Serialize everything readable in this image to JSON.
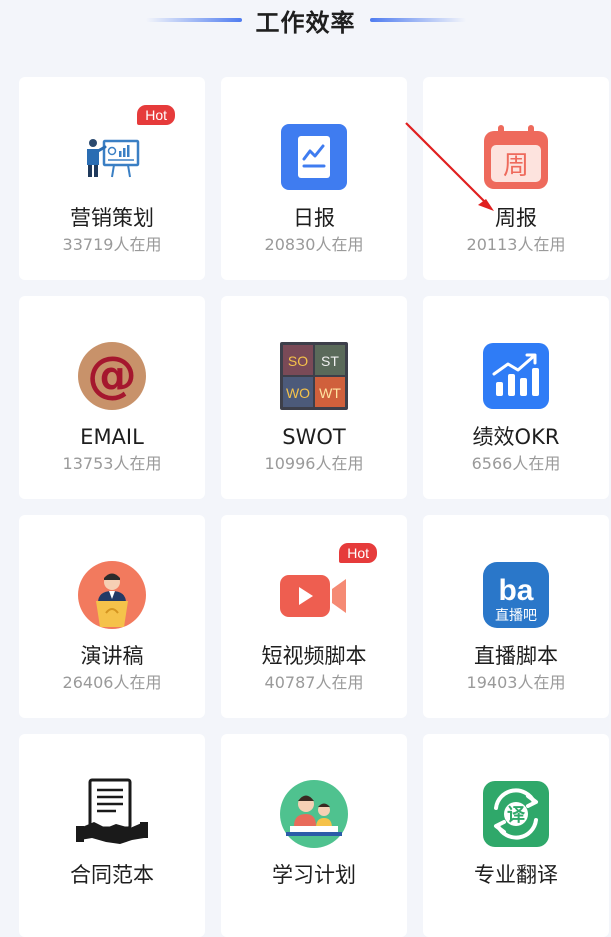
{
  "header": {
    "title": "工作效率"
  },
  "badge_text": "Hot",
  "colors": {
    "accent": "#4f7cf0",
    "hot": "#e63b3b",
    "user_count": "#9a9a9a"
  },
  "tools": [
    {
      "name": "营销策划",
      "users": "33719人在用",
      "icon": "presentation-board-icon",
      "hot": true
    },
    {
      "name": "日报",
      "users": "20830人在用",
      "icon": "daily-report-icon",
      "hot": false
    },
    {
      "name": "周报",
      "users": "20113人在用",
      "icon": "calendar-icon",
      "icon_text": "周",
      "hot": false
    },
    {
      "name": "EMAIL",
      "users": "13753人在用",
      "icon": "email-at-icon",
      "hot": false
    },
    {
      "name": "SWOT",
      "users": "10996人在用",
      "icon": "swot-grid-icon",
      "icon_text": [
        "SO",
        "ST",
        "WO",
        "WT"
      ],
      "hot": false
    },
    {
      "name": "绩效OKR",
      "users": "6566人在用",
      "icon": "growth-chart-icon",
      "hot": false
    },
    {
      "name": "演讲稿",
      "users": "26406人在用",
      "icon": "speaker-podium-icon",
      "hot": false
    },
    {
      "name": "短视频脚本",
      "users": "40787人在用",
      "icon": "video-camera-icon",
      "hot": true
    },
    {
      "name": "直播脚本",
      "users": "19403人在用",
      "icon": "live-stream-icon",
      "icon_text": [
        "ba",
        "直播吧"
      ],
      "hot": false
    },
    {
      "name": "合同范本",
      "users": "",
      "icon": "contract-handshake-icon",
      "hot": false
    },
    {
      "name": "学习计划",
      "users": "",
      "icon": "study-plan-icon",
      "hot": false
    },
    {
      "name": "专业翻译",
      "users": "",
      "icon": "translate-icon",
      "icon_text": "译",
      "hot": false
    }
  ]
}
